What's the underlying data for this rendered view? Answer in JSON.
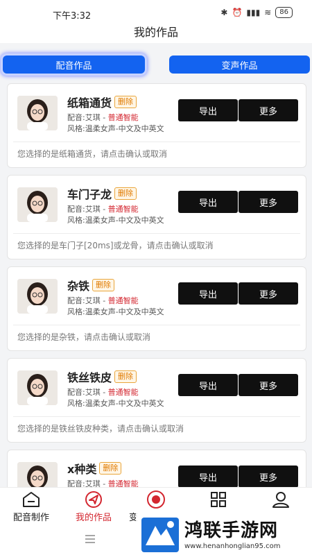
{
  "status_bar": {
    "time": "下午3:32",
    "battery": "86"
  },
  "header": {
    "title": "我的作品"
  },
  "tabs": [
    {
      "label": "配音作品",
      "active": true
    },
    {
      "label": "变声作品",
      "active": false
    }
  ],
  "cards": [
    {
      "name": "纸箱通货",
      "badge": "删除",
      "voice_prefix": "配音:艾琪 - ",
      "voice_highlight": "普通智能",
      "style": "风格:温柔女声-中文及中英文",
      "export_label": "导出",
      "more_label": "更多",
      "prompt": "您选择的是纸箱通货，请点击确认或取消"
    },
    {
      "name": "车门子龙",
      "badge": "删除",
      "voice_prefix": "配音:艾琪 - ",
      "voice_highlight": "普通智能",
      "style": "风格:温柔女声-中文及中英文",
      "export_label": "导出",
      "more_label": "更多",
      "prompt": "您选择的是车门子[20ms]或龙骨，请点击确认或取消"
    },
    {
      "name": "杂铁",
      "badge": "删除",
      "voice_prefix": "配音:艾琪 - ",
      "voice_highlight": "普通智能",
      "style": "风格:温柔女声-中文及中英文",
      "export_label": "导出",
      "more_label": "更多",
      "prompt": "您选择的是杂铁，请点击确认或取消"
    },
    {
      "name": "铁丝铁皮",
      "badge": "删除",
      "voice_prefix": "配音:艾琪 - ",
      "voice_highlight": "普通智能",
      "style": "风格:温柔女声-中文及中英文",
      "export_label": "导出",
      "more_label": "更多",
      "prompt": "您选择的是铁丝铁皮种类，请点击确认或取消"
    },
    {
      "name": "x种类",
      "badge": "删除",
      "voice_prefix": "配音:艾琪 - ",
      "voice_highlight": "普通智能",
      "style": "",
      "export_label": "导出",
      "more_label": "更多",
      "prompt": ""
    }
  ],
  "bottom_tabs": [
    {
      "label": "配音制作",
      "icon": "home-icon",
      "active": false
    },
    {
      "label": "我的作品",
      "icon": "send-icon",
      "active": true
    },
    {
      "label": "变",
      "icon": "record-icon",
      "active": false
    },
    {
      "label": "",
      "icon": "grid-icon",
      "active": false
    },
    {
      "label": "",
      "icon": "user-icon",
      "active": false
    }
  ],
  "watermark": {
    "title": "鸿联手游网",
    "url": "www.henanhonglian95.com"
  },
  "colors": {
    "accent_blue": "#1363f0",
    "highlight_red": "#d3262f",
    "badge_orange": "#e07a00",
    "button_black": "#101010"
  }
}
